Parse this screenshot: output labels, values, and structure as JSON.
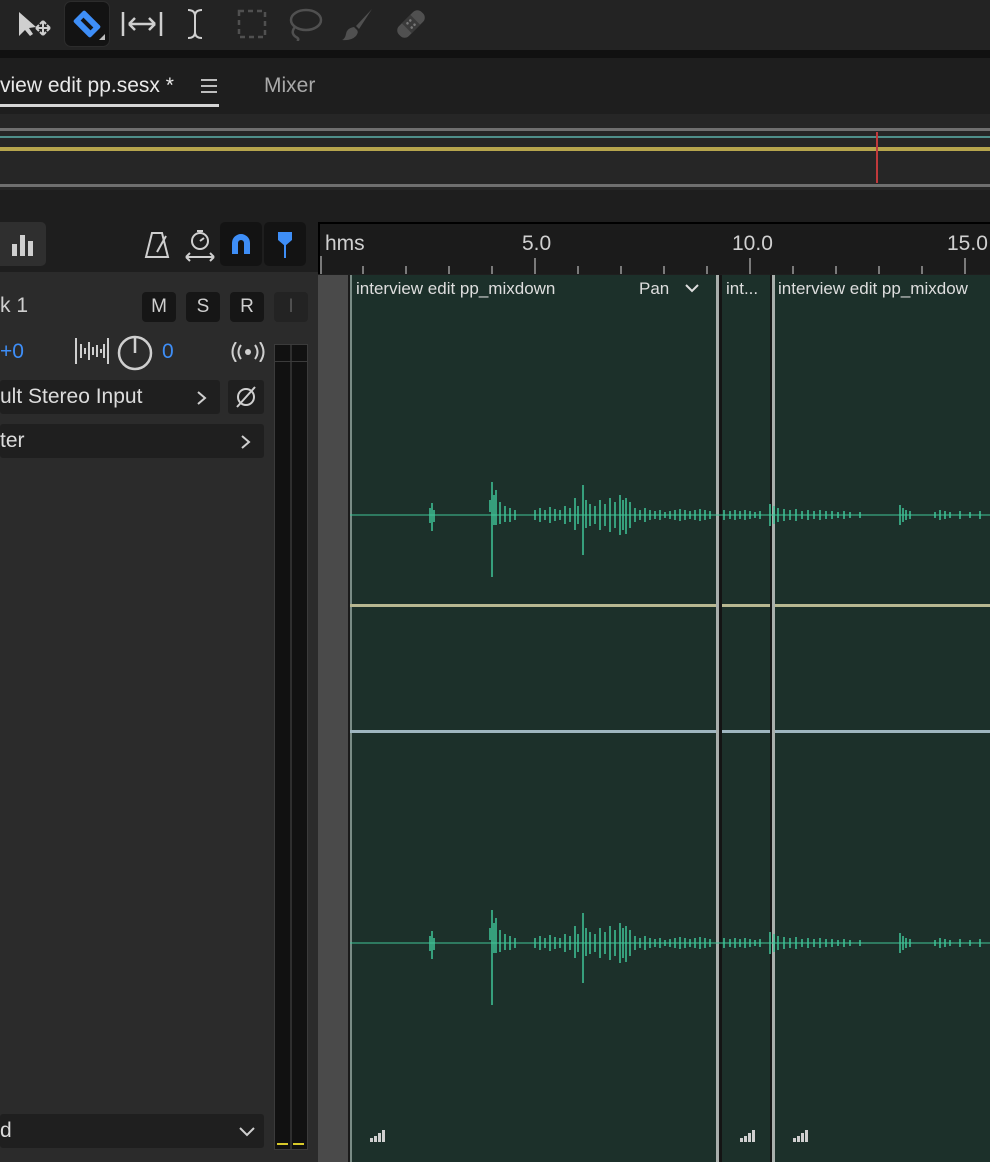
{
  "toolbar": {
    "tools": [
      {
        "name": "move-tool",
        "active": false
      },
      {
        "name": "razor-tool",
        "active": true
      },
      {
        "name": "slip-tool",
        "active": false
      },
      {
        "name": "time-selection-tool",
        "active": false
      },
      {
        "name": "marquee-tool",
        "active": false
      },
      {
        "name": "lasso-tool",
        "active": false
      },
      {
        "name": "brush-tool",
        "active": false
      },
      {
        "name": "spot-healing-tool",
        "active": false
      }
    ]
  },
  "tabs": {
    "session": "view edit pp.sesx *",
    "mixer": "Mixer"
  },
  "ruler": {
    "unit_label": "hms",
    "ticks": [
      "5.0",
      "10.0",
      "15.0"
    ]
  },
  "track": {
    "name_partial": "k 1",
    "mute_label": "M",
    "solo_label": "S",
    "record_label": "R",
    "input_monitor_label": "I",
    "volume_value": "+0",
    "pan_value": "0",
    "input_label": "ult Stereo Input",
    "output_label": "ter",
    "bottom_select": "d"
  },
  "clips": [
    {
      "title": "interview edit pp_mixdown",
      "control": "Pan"
    },
    {
      "title": "int..."
    },
    {
      "title": "interview edit pp_mixdow"
    }
  ],
  "colors": {
    "accent_blue": "#3e8ef7",
    "waveform": "#3fc497",
    "clip_bg": "#1c302a",
    "playhead": "#c0393b",
    "overview_yellow": "#b6a54d"
  }
}
